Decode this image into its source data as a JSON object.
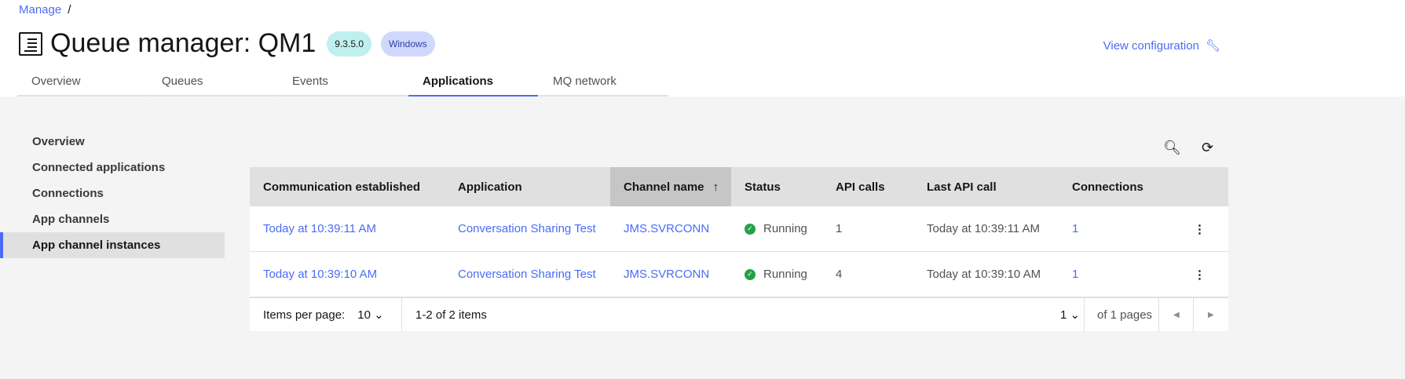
{
  "breadcrumb": {
    "manage": "Manage",
    "sep": "/"
  },
  "header": {
    "title": "Queue manager: QM1",
    "version": "9.3.5.0",
    "platform": "Windows",
    "view_config": "View configuration"
  },
  "tabs": [
    "Overview",
    "Queues",
    "Events",
    "Applications",
    "MQ network"
  ],
  "sidebar": [
    "Overview",
    "Connected applications",
    "Connections",
    "App channels",
    "App channel instances"
  ],
  "table": {
    "columns": [
      "Communication established",
      "Application",
      "Channel name",
      "Status",
      "API calls",
      "Last API call",
      "Connections"
    ],
    "sort_icon": "↑",
    "rows": [
      {
        "established": "Today at 10:39:11 AM",
        "application": "Conversation Sharing Test",
        "channel": "JMS.SVRCONN",
        "status": "Running",
        "api_calls": "1",
        "last_api": "Today at 10:39:11 AM",
        "connections": "1"
      },
      {
        "established": "Today at 10:39:10 AM",
        "application": "Conversation Sharing Test",
        "channel": "JMS.SVRCONN",
        "status": "Running",
        "api_calls": "4",
        "last_api": "Today at 10:39:10 AM",
        "connections": "1"
      }
    ]
  },
  "pagination": {
    "items_per_page_label": "Items per page:",
    "items_per_page": "10",
    "range": "1-2 of 2 items",
    "page": "1",
    "of_pages": "of 1 pages"
  },
  "colors": {
    "accent": "#4a6cf7",
    "running": "#24a148"
  }
}
